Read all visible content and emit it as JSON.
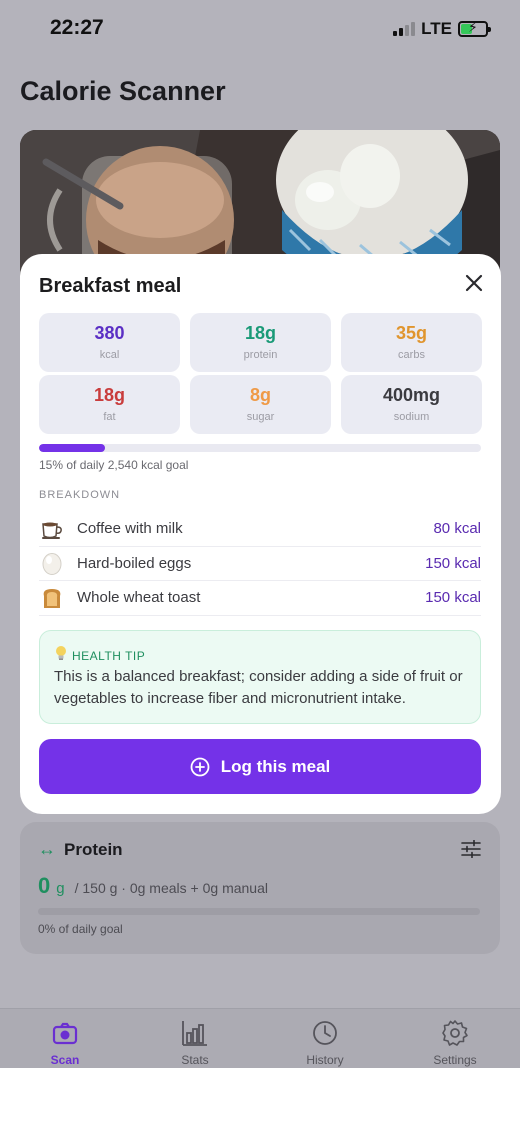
{
  "status": {
    "time": "22:27",
    "network": "LTE"
  },
  "header": {
    "title": "Calorie Scanner"
  },
  "modal": {
    "title": "Breakfast meal",
    "nutrients": [
      {
        "value": "380",
        "label": "kcal",
        "color": "#5b2fc4"
      },
      {
        "value": "18g",
        "label": "protein",
        "color": "#1a9a77"
      },
      {
        "value": "35g",
        "label": "carbs",
        "color": "#e0952e"
      },
      {
        "value": "18g",
        "label": "fat",
        "color": "#c93c3c"
      },
      {
        "value": "8g",
        "label": "sugar",
        "color": "#ef9a47"
      },
      {
        "value": "400mg",
        "label": "sodium",
        "color": "#3b3b40"
      }
    ],
    "goal_progress": 0.15,
    "goal_text": "15% of daily 2,540 kcal goal",
    "breakdown_heading": "BREAKDOWN",
    "items": [
      {
        "icon": "coffee-icon",
        "name": "Coffee with milk",
        "kcal": "80 kcal"
      },
      {
        "icon": "egg-icon",
        "name": "Hard-boiled eggs",
        "kcal": "150 kcal"
      },
      {
        "icon": "toast-icon",
        "name": "Whole wheat toast",
        "kcal": "150 kcal"
      }
    ],
    "tip_heading": "HEALTH TIP",
    "tip_text": "This is a balanced breakfast; consider adding a side of fruit or vegetables to increase fiber and micronutrient intake.",
    "log_button": "Log this meal",
    "accent": "#7432e8"
  },
  "protein_card": {
    "title": "Protein",
    "value": "0",
    "unit": "g",
    "detail": "/ 150 g · 0g meals + 0g manual",
    "progress": 0,
    "percent_text": "0% of daily goal"
  },
  "tabs": [
    {
      "label": "Scan",
      "icon": "camera-icon",
      "active": true
    },
    {
      "label": "Stats",
      "icon": "bar-chart-icon",
      "active": false
    },
    {
      "label": "History",
      "icon": "clock-icon",
      "active": false
    },
    {
      "label": "Settings",
      "icon": "gear-icon",
      "active": false
    }
  ]
}
